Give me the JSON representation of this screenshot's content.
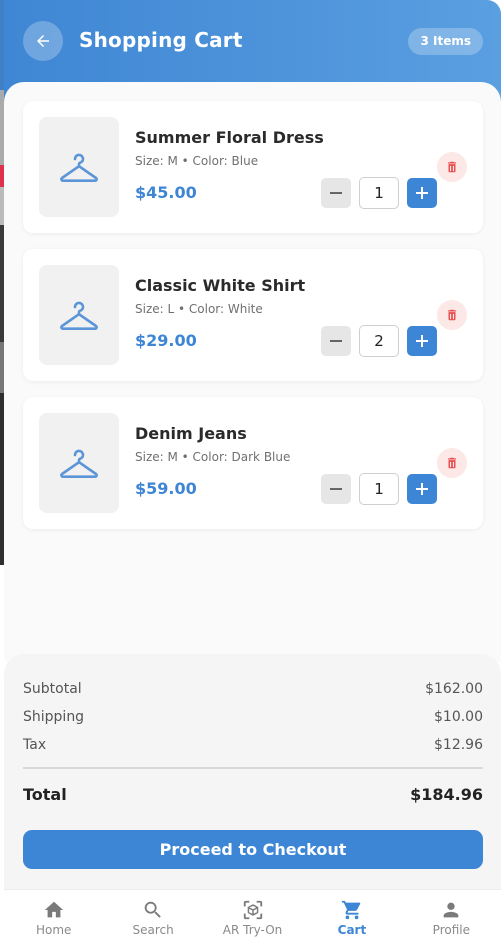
{
  "header": {
    "title": "Shopping Cart",
    "items_badge": "3 Items"
  },
  "cart": {
    "items": [
      {
        "name": "Summer Floral Dress",
        "meta": "Size: M • Color: Blue",
        "price": "$45.00",
        "quantity": "1"
      },
      {
        "name": "Classic White Shirt",
        "meta": "Size: L • Color: White",
        "price": "$29.00",
        "quantity": "2"
      },
      {
        "name": "Denim Jeans",
        "meta": "Size: M • Color: Dark Blue",
        "price": "$59.00",
        "quantity": "1"
      }
    ]
  },
  "summary": {
    "subtotal_label": "Subtotal",
    "subtotal_value": "$162.00",
    "shipping_label": "Shipping",
    "shipping_value": "$10.00",
    "tax_label": "Tax",
    "tax_value": "$12.96",
    "total_label": "Total",
    "total_value": "$184.96",
    "checkout_label": "Proceed to Checkout"
  },
  "nav": {
    "items": [
      {
        "label": "Home",
        "icon": "home-icon"
      },
      {
        "label": "Search",
        "icon": "search-icon"
      },
      {
        "label": "AR Try-On",
        "icon": "ar-cube-icon"
      },
      {
        "label": "Cart",
        "icon": "cart-icon",
        "active": true
      },
      {
        "label": "Profile",
        "icon": "person-icon"
      }
    ]
  },
  "colors": {
    "accent": "#3d86d6",
    "header_gradient_start": "#3f86d4",
    "header_gradient_end": "#5a9fe0",
    "delete": "#e74c4c",
    "delete_bg": "#fde8e8",
    "inactive_nav": "#8a8a8a"
  }
}
